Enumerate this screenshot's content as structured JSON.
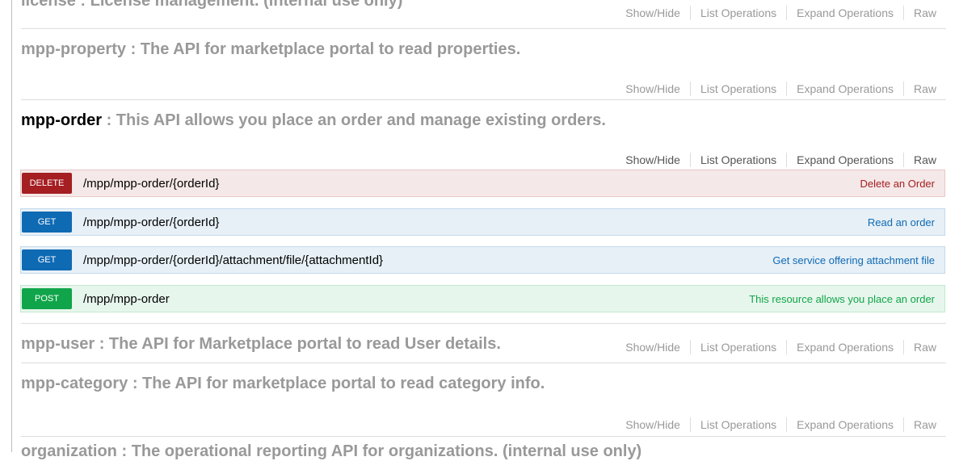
{
  "ops_labels": {
    "show_hide": "Show/Hide",
    "list_operations": "List Operations",
    "expand_operations": "Expand Operations",
    "raw": "Raw"
  },
  "sections": [
    {
      "name": "license",
      "separator": ":",
      "description": "License management. (internal use only)"
    },
    {
      "name": "mpp-property",
      "separator": ":",
      "description": "The API for marketplace portal to read properties."
    },
    {
      "name": "mpp-order",
      "separator": ":",
      "description": "This API allows you place an order and manage existing orders.",
      "expanded": true
    },
    {
      "name": "mpp-user",
      "separator": ":",
      "description": "The API for Marketplace portal to read User details."
    },
    {
      "name": "mpp-category",
      "separator": ":",
      "description": "The API for marketplace portal to read category info."
    },
    {
      "name": "organization",
      "separator": ":",
      "description": "The operational reporting API for organizations. (internal use only)"
    }
  ],
  "operations": [
    {
      "method": "DELETE",
      "path": "/mpp/mpp-order/{orderId}",
      "summary": "Delete an Order",
      "color": "#a41e22"
    },
    {
      "method": "GET",
      "path": "/mpp/mpp-order/{orderId}",
      "summary": "Read an order",
      "color": "#0f6ab4"
    },
    {
      "method": "GET",
      "path": "/mpp/mpp-order/{orderId}/attachment/file/{attachmentId}",
      "summary": "Get service offering attachment file",
      "color": "#0f6ab4"
    },
    {
      "method": "POST",
      "path": "/mpp/mpp-order",
      "summary": "This resource allows you place an order",
      "color": "#10a54a"
    }
  ]
}
